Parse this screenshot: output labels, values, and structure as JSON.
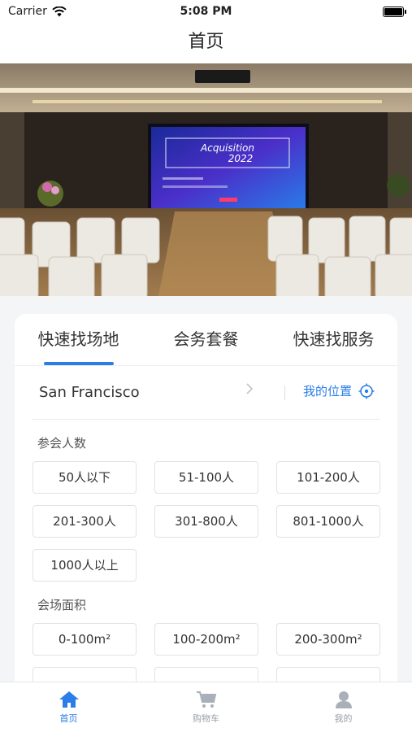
{
  "status_bar": {
    "carrier": "Carrier",
    "time": "5:08 PM"
  },
  "nav": {
    "title": "首页"
  },
  "hero": {
    "screen_line1": "Acquisition",
    "screen_line2": "2022"
  },
  "tabs": [
    {
      "label": "快速找场地",
      "active": true
    },
    {
      "label": "会务套餐"
    },
    {
      "label": "快速找服务"
    }
  ],
  "location": {
    "city": "San Francisco",
    "my_location": "我的位置"
  },
  "attendees": {
    "title": "参会人数",
    "options": [
      "50人以下",
      "51-100人",
      "101-200人",
      "201-300人",
      "301-800人",
      "801-1000人",
      "1000人以上"
    ]
  },
  "area": {
    "title": "会场面积",
    "options": [
      "0-100m²",
      "100-200m²",
      "200-300m²"
    ]
  },
  "tab_bar": {
    "home": "首页",
    "cart": "购物车",
    "mine": "我的",
    "accent": "#2b7de9"
  }
}
